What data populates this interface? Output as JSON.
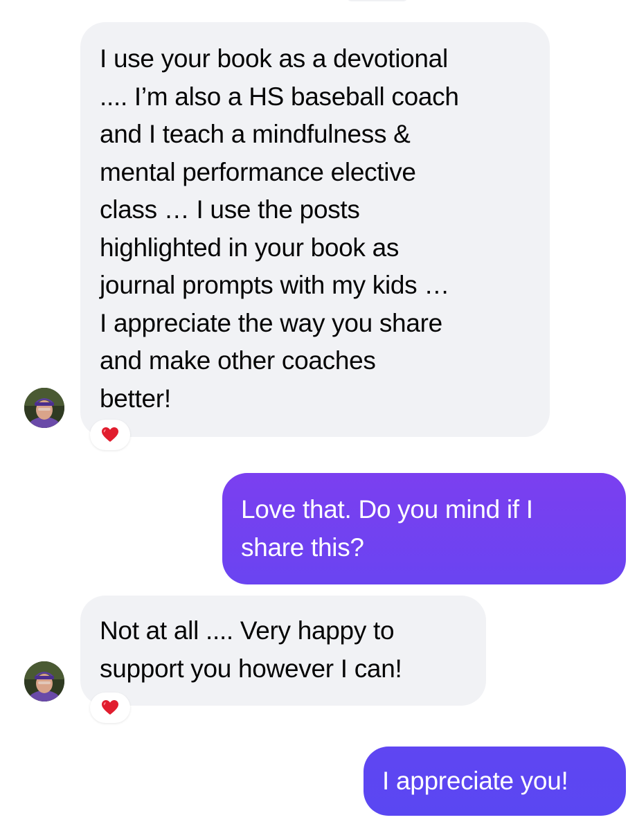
{
  "colors": {
    "incoming_bubble": "#f1f2f5",
    "incoming_text": "#050505",
    "outgoing_gradient_top": "#7b3ff0",
    "outgoing_gradient_bottom": "#5a47f2",
    "outgoing_text": "#ffffff",
    "reaction_heart": "#e11d2e"
  },
  "messages": [
    {
      "sender": "them",
      "lines": [
        "I use your book as a devotional",
        ".... I’m also a HS baseball coach",
        "and I teach a mindfulness &",
        "mental performance elective",
        "class … I use the posts",
        "highlighted in your book as",
        "journal prompts with my kids …",
        "I appreciate the way you share",
        "and make other coaches",
        "better!"
      ],
      "reaction": "red-heart-icon"
    },
    {
      "sender": "me",
      "lines": [
        "Love that.  Do you mind if I",
        "share this?"
      ]
    },
    {
      "sender": "them",
      "lines": [
        "Not at all .... Very happy to",
        "support you however I can!"
      ],
      "reaction": "red-heart-icon"
    },
    {
      "sender": "me",
      "lines": [
        "I appreciate you!"
      ]
    }
  ]
}
